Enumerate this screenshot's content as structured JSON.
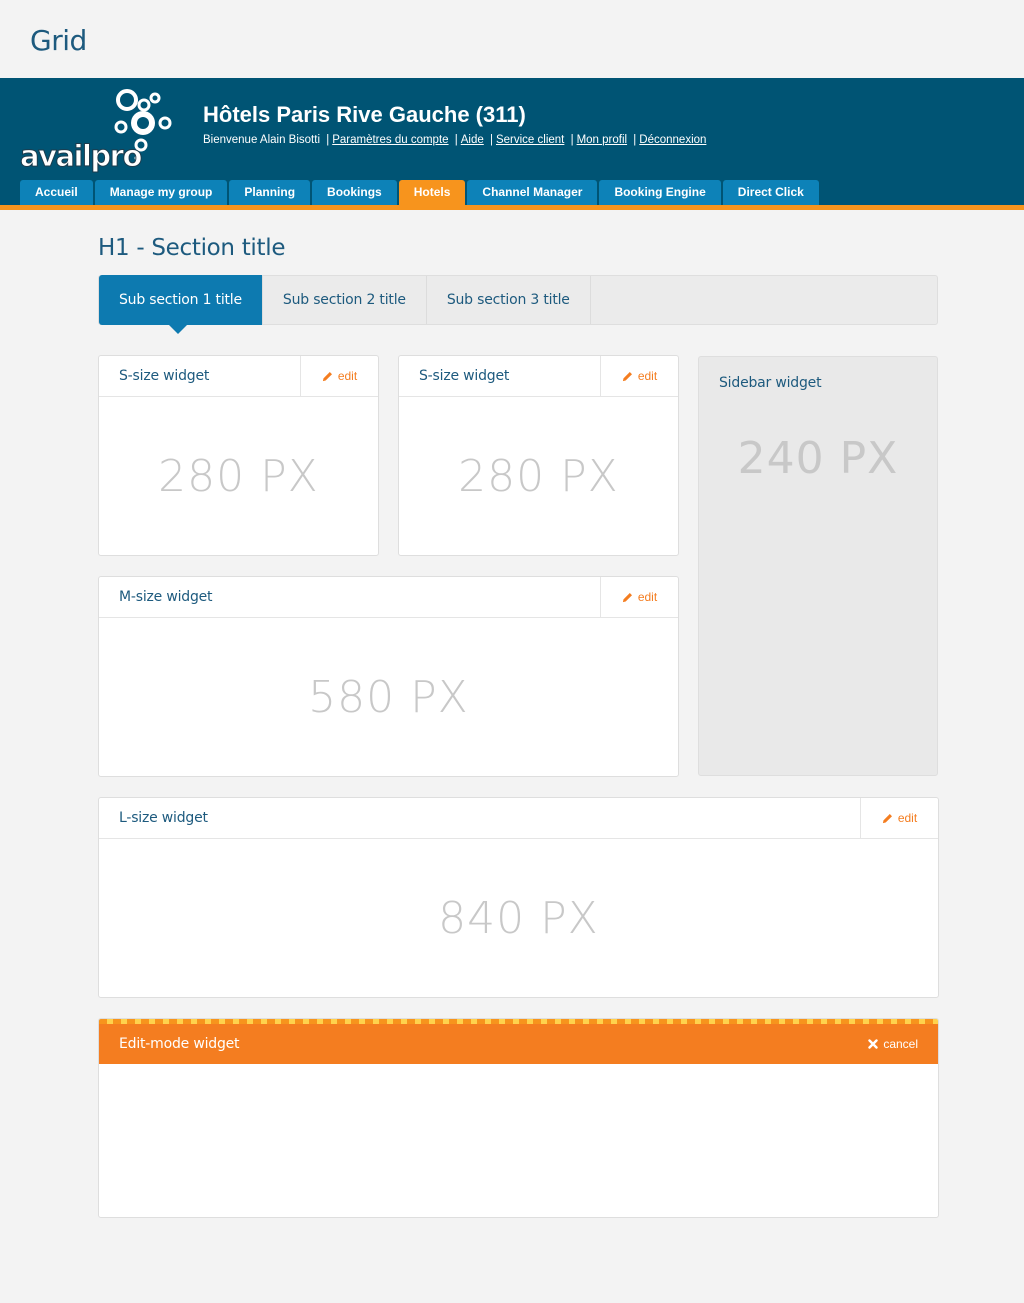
{
  "page": {
    "title": "Grid"
  },
  "header": {
    "logo_text": "availpro",
    "hotel_name": "Hôtels Paris Rive Gauche (311)",
    "welcome": "Bienvenue Alain Bisotti",
    "links": [
      "Paramètres du compte",
      "Aide",
      "Service client",
      "Mon profil",
      "Déconnexion"
    ],
    "separator": "|"
  },
  "nav": {
    "tabs": [
      "Accueil",
      "Manage my group",
      "Planning",
      "Bookings",
      "Hotels",
      "Channel Manager",
      "Booking Engine",
      "Direct Click"
    ],
    "active": "Hotels"
  },
  "colors": {
    "brand": "#005474",
    "accent": "#f7941d",
    "tab": "#0d82b8"
  },
  "section": {
    "title": "H1 - Section title",
    "subtabs": [
      "Sub section 1 title",
      "Sub section 2 title",
      "Sub section 3 title"
    ],
    "active_subtab": "Sub section 1 title"
  },
  "widgets": {
    "edit_label": "edit",
    "s1": {
      "title": "S-size widget",
      "size": "280 PX"
    },
    "s2": {
      "title": "S-size widget",
      "size": "280 PX"
    },
    "m": {
      "title": "M-size widget",
      "size": "580 PX"
    },
    "l": {
      "title": "L-size widget",
      "size": "840 PX"
    },
    "sidebar": {
      "title": "Sidebar widget",
      "size": "240 PX"
    },
    "edit_mode": {
      "title": "Edit-mode widget",
      "cancel_label": "cancel"
    }
  },
  "icons": {
    "edit": "pencil-icon",
    "cancel": "close-icon"
  }
}
